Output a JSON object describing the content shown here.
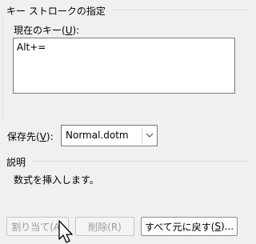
{
  "group": {
    "title": "キー ストロークの指定"
  },
  "current_keys": {
    "label_text": "現在のキー(",
    "label_mnemonic": "U",
    "label_suffix": "):",
    "items": [
      "Alt+="
    ]
  },
  "save_in": {
    "label_text": "保存先(",
    "label_mnemonic": "V",
    "label_suffix": "):",
    "selected": "Normal.dotm"
  },
  "description": {
    "title": "説明",
    "text": "数式を挿入します。"
  },
  "buttons": {
    "assign": "割り当て(A)",
    "remove": "削除(R)",
    "reset_text": "すべて元に戻す(",
    "reset_mnemonic": "S",
    "reset_suffix": ")..."
  },
  "icons": {
    "combo_arrow": "chevron-down-icon",
    "cursor": "mouse-pointer-icon"
  }
}
